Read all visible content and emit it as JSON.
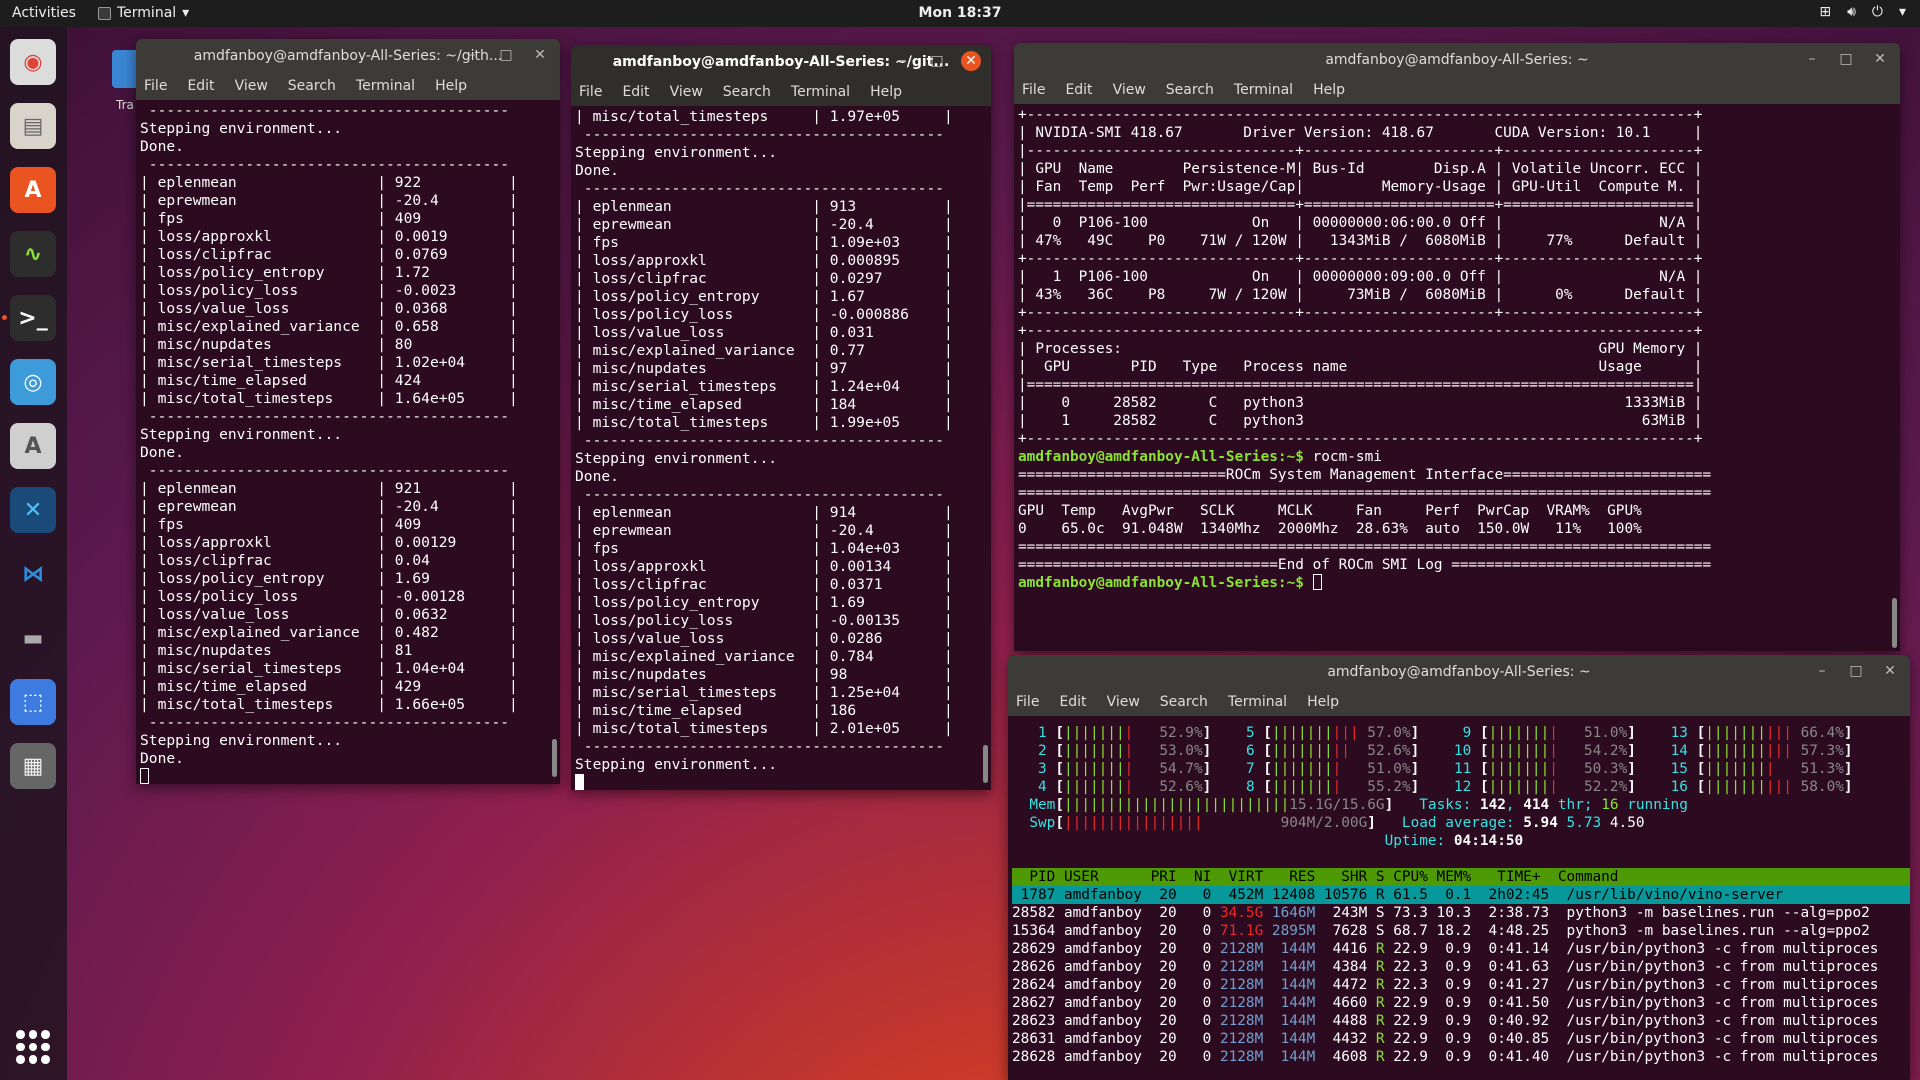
{
  "topbar": {
    "activities": "Activities",
    "app": "Terminal",
    "clock": "Mon 18:37"
  },
  "dock": {
    "items": [
      {
        "name": "chrome-icon",
        "bg": "#dcdcdc",
        "glyph": "◉",
        "color": "#db4437"
      },
      {
        "name": "files-icon",
        "bg": "#d8d4cc",
        "glyph": "▤",
        "color": "#666"
      },
      {
        "name": "software-center-icon",
        "bg": "#e95420",
        "glyph": "A",
        "color": "#fff"
      },
      {
        "name": "system-monitor-icon",
        "bg": "#2d2d2d",
        "glyph": "∿",
        "color": "#8ae234"
      },
      {
        "name": "terminal-icon",
        "bg": "#2d2d2d",
        "glyph": ">_",
        "color": "#fff"
      },
      {
        "name": "browser-globe-icon",
        "bg": "#3d9bd9",
        "glyph": "◎",
        "color": "#fff"
      },
      {
        "name": "software-updater-icon",
        "bg": "#cfcfcf",
        "glyph": "A",
        "color": "#555"
      },
      {
        "name": "remote-app-icon",
        "bg": "#1a4a7a",
        "glyph": "✕",
        "color": "#4fc3f7"
      },
      {
        "name": "vscode-icon",
        "bg": "transparent",
        "glyph": "⋈",
        "color": "#2b8fe0"
      },
      {
        "name": "anbox-icon",
        "bg": "transparent",
        "glyph": "▬",
        "color": "#aaa"
      },
      {
        "name": "screenshot-icon",
        "bg": "#3d7be0",
        "glyph": "⬚",
        "color": "#fff"
      },
      {
        "name": "video-editor-icon",
        "bg": "#666",
        "glyph": "▦",
        "color": "#eee"
      }
    ]
  },
  "desktop": {
    "trash_label": "Tra"
  },
  "menu": [
    "File",
    "Edit",
    "View",
    "Search",
    "Terminal",
    "Help"
  ],
  "windows": {
    "w1": {
      "title": "amdfanboy@amdfanboy-All-Series: ~/gith...",
      "lines": [
        " -----------------------------------------",
        "Stepping environment...",
        "Done.",
        " -----------------------------------------",
        "| eplenmean                | 922          |",
        "| eprewmean                | -20.4        |",
        "| fps                      | 409          |",
        "| loss/approxkl            | 0.0019       |",
        "| loss/clipfrac            | 0.0769       |",
        "| loss/policy_entropy      | 1.72         |",
        "| loss/policy_loss         | -0.0023      |",
        "| loss/value_loss          | 0.0368       |",
        "| misc/explained_variance  | 0.658        |",
        "| misc/nupdates            | 80           |",
        "| misc/serial_timesteps    | 1.02e+04     |",
        "| misc/time_elapsed        | 424          |",
        "| misc/total_timesteps     | 1.64e+05     |",
        " -----------------------------------------",
        "Stepping environment...",
        "Done.",
        " -----------------------------------------",
        "| eplenmean                | 921          |",
        "| eprewmean                | -20.4        |",
        "| fps                      | 409          |",
        "| loss/approxkl            | 0.00129      |",
        "| loss/clipfrac            | 0.04         |",
        "| loss/policy_entropy      | 1.69         |",
        "| loss/policy_loss         | -0.00128     |",
        "| loss/value_loss          | 0.0632       |",
        "| misc/explained_variance  | 0.482        |",
        "| misc/nupdates            | 81           |",
        "| misc/serial_timesteps    | 1.04e+04     |",
        "| misc/time_elapsed        | 429          |",
        "| misc/total_timesteps     | 1.66e+05     |",
        " -----------------------------------------",
        "Stepping environment...",
        "Done."
      ]
    },
    "w2": {
      "title": "amdfanboy@amdfanboy-All-Series: ~/git...",
      "lines": [
        "| misc/total_timesteps     | 1.97e+05     |",
        " -----------------------------------------",
        "Stepping environment...",
        "Done.",
        " -----------------------------------------",
        "| eplenmean                | 913          |",
        "| eprewmean                | -20.4        |",
        "| fps                      | 1.09e+03     |",
        "| loss/approxkl            | 0.000895     |",
        "| loss/clipfrac            | 0.0297       |",
        "| loss/policy_entropy      | 1.67         |",
        "| loss/policy_loss         | -0.000886    |",
        "| loss/value_loss          | 0.031        |",
        "| misc/explained_variance  | 0.77         |",
        "| misc/nupdates            | 97           |",
        "| misc/serial_timesteps    | 1.24e+04     |",
        "| misc/time_elapsed        | 184          |",
        "| misc/total_timesteps     | 1.99e+05     |",
        " -----------------------------------------",
        "Stepping environment...",
        "Done.",
        " -----------------------------------------",
        "| eplenmean                | 914          |",
        "| eprewmean                | -20.4        |",
        "| fps                      | 1.04e+03     |",
        "| loss/approxkl            | 0.00134      |",
        "| loss/clipfrac            | 0.0371       |",
        "| loss/policy_entropy      | 1.69         |",
        "| loss/policy_loss         | -0.00135     |",
        "| loss/value_loss          | 0.0286       |",
        "| misc/explained_variance  | 0.784        |",
        "| misc/nupdates            | 98           |",
        "| misc/serial_timesteps    | 1.25e+04     |",
        "| misc/time_elapsed        | 186          |",
        "| misc/total_timesteps     | 2.01e+05     |",
        " -----------------------------------------",
        "Stepping environment..."
      ]
    },
    "w3": {
      "title": "amdfanboy@amdfanboy-All-Series: ~",
      "lines": [
        "+-----------------------------------------------------------------------------+",
        "| NVIDIA-SMI 418.67       Driver Version: 418.67       CUDA Version: 10.1     |",
        "|-------------------------------+----------------------+----------------------+",
        "| GPU  Name        Persistence-M| Bus-Id        Disp.A | Volatile Uncorr. ECC |",
        "| Fan  Temp  Perf  Pwr:Usage/Cap|         Memory-Usage | GPU-Util  Compute M. |",
        "|===============================+======================+======================|",
        "|   0  P106-100            On   | 00000000:06:00.0 Off |                  N/A |",
        "| 47%   49C    P0    71W / 120W |   1343MiB /  6080MiB |     77%      Default |",
        "+-------------------------------+----------------------+----------------------+",
        "|   1  P106-100            On   | 00000000:09:00.0 Off |                  N/A |",
        "| 43%   36C    P8     7W / 120W |     73MiB /  6080MiB |      0%      Default |",
        "+-------------------------------+----------------------+----------------------+",
        "",
        "+-----------------------------------------------------------------------------+",
        "| Processes:                                                       GPU Memory |",
        "|  GPU       PID   Type   Process name                             Usage      |",
        "|=============================================================================|",
        "|    0     28582      C   python3                                     1333MiB |",
        "|    1     28582      C   python3                                       63MiB |",
        "+-----------------------------------------------------------------------------+"
      ],
      "prompt": "amdfanboy@amdfanboy-All-Series:~$",
      "cmd": " rocm-smi",
      "lines2": [
        "",
        "",
        "========================ROCm System Management Interface========================",
        "================================================================================",
        "GPU  Temp   AvgPwr   SCLK     MCLK     Fan     Perf  PwrCap  VRAM%  GPU%",
        "0    65.0c  91.048W  1340Mhz  2000Mhz  28.63%  auto  150.0W   11%   100%",
        "================================================================================",
        "==============================End of ROCm SMI Log =============================="
      ],
      "prompt2": "amdfanboy@amdfanboy-All-Series:~$"
    },
    "w4": {
      "title": "amdfanboy@amdfanboy-All-Series: ~",
      "cpus": [
        [
          {
            "n": "1",
            "b": "||||||||",
            "p": "52.9%"
          },
          {
            "n": "5",
            "b": "||||||||||",
            "p": "57.0%"
          },
          {
            "n": "9",
            "b": "||||||||",
            "p": "51.0%"
          },
          {
            "n": "13",
            "b": "||||||||||",
            "p": "66.4%"
          }
        ],
        [
          {
            "n": "2",
            "b": "||||||||",
            "p": "53.0%"
          },
          {
            "n": "6",
            "b": "|||||||||",
            "p": "52.6%"
          },
          {
            "n": "10",
            "b": "||||||||",
            "p": "54.2%"
          },
          {
            "n": "14",
            "b": "||||||||||",
            "p": "57.3%"
          }
        ],
        [
          {
            "n": "3",
            "b": "||||||||",
            "p": "54.7%"
          },
          {
            "n": "7",
            "b": "||||||||",
            "p": "51.0%"
          },
          {
            "n": "11",
            "b": "||||||||",
            "p": "50.3%"
          },
          {
            "n": "15",
            "b": "||||||||",
            "p": "51.3%"
          }
        ],
        [
          {
            "n": "4",
            "b": "||||||||",
            "p": "52.6%"
          },
          {
            "n": "8",
            "b": "||||||||",
            "p": "55.2%"
          },
          {
            "n": "12",
            "b": "||||||||",
            "p": "52.2%"
          },
          {
            "n": "16",
            "b": "||||||||||",
            "p": "58.0%"
          }
        ]
      ],
      "mem": {
        "label": "Mem",
        "bar": "||||||||||||||||||||||||||",
        "val": "15.1G/15.6G"
      },
      "swp": {
        "label": "Swp",
        "bar": "||||||||||||||||",
        "val": "904M/2.00G"
      },
      "tasks": {
        "label": "Tasks: ",
        "n": "142",
        "sep": ", ",
        "thr": "414",
        "thr_l": " thr; ",
        "run": "16",
        "run_l": " running"
      },
      "load": {
        "label": "Load average: ",
        "a": "5.94",
        "b": "5.73",
        "c": "4.50"
      },
      "uptime": {
        "label": "Uptime: ",
        "v": "04:14:50"
      },
      "header": "  PID USER      PRI  NI  VIRT   RES   SHR S CPU% MEM%   TIME+  Command",
      "procs": [
        {
          "pid": " 1787",
          "user": "amdfanboy",
          "pri": "20",
          "ni": "0",
          "virt": "452M",
          "res": "12408",
          "shr": "10576",
          "s": "R",
          "cpu": "61.5",
          "mem": "0.1",
          "time": "2h02:45",
          "cmd": "/usr/lib/vino/vino-server"
        },
        {
          "pid": "28582",
          "user": "amdfanboy",
          "pri": "20",
          "ni": "0",
          "virt": "34.5G",
          "res": "1646M",
          "shr": "243M",
          "s": "S",
          "cpu": "73.3",
          "mem": "10.3",
          "time": "2:38.73",
          "cmd": "python3 -m baselines.run --alg=ppo2"
        },
        {
          "pid": "15364",
          "user": "amdfanboy",
          "pri": "20",
          "ni": "0",
          "virt": "71.1G",
          "res": "2895M",
          "shr": "7628",
          "s": "S",
          "cpu": "68.7",
          "mem": "18.2",
          "time": "4:48.25",
          "cmd": "python3 -m baselines.run --alg=ppo2"
        },
        {
          "pid": "28629",
          "user": "amdfanboy",
          "pri": "20",
          "ni": "0",
          "virt": "2128M",
          "res": "144M",
          "shr": "4416",
          "s": "R",
          "cpu": "22.9",
          "mem": "0.9",
          "time": "0:41.14",
          "cmd": "/usr/bin/python3 -c from multiproces"
        },
        {
          "pid": "28626",
          "user": "amdfanboy",
          "pri": "20",
          "ni": "0",
          "virt": "2128M",
          "res": "144M",
          "shr": "4384",
          "s": "R",
          "cpu": "22.3",
          "mem": "0.9",
          "time": "0:41.63",
          "cmd": "/usr/bin/python3 -c from multiproces"
        },
        {
          "pid": "28624",
          "user": "amdfanboy",
          "pri": "20",
          "ni": "0",
          "virt": "2128M",
          "res": "144M",
          "shr": "4472",
          "s": "R",
          "cpu": "22.3",
          "mem": "0.9",
          "time": "0:41.27",
          "cmd": "/usr/bin/python3 -c from multiproces"
        },
        {
          "pid": "28627",
          "user": "amdfanboy",
          "pri": "20",
          "ni": "0",
          "virt": "2128M",
          "res": "144M",
          "shr": "4660",
          "s": "R",
          "cpu": "22.9",
          "mem": "0.9",
          "time": "0:41.50",
          "cmd": "/usr/bin/python3 -c from multiproces"
        },
        {
          "pid": "28623",
          "user": "amdfanboy",
          "pri": "20",
          "ni": "0",
          "virt": "2128M",
          "res": "144M",
          "shr": "4488",
          "s": "R",
          "cpu": "22.9",
          "mem": "0.9",
          "time": "0:40.92",
          "cmd": "/usr/bin/python3 -c from multiproces"
        },
        {
          "pid": "28631",
          "user": "amdfanboy",
          "pri": "20",
          "ni": "0",
          "virt": "2128M",
          "res": "144M",
          "shr": "4432",
          "s": "R",
          "cpu": "22.9",
          "mem": "0.9",
          "time": "0:40.85",
          "cmd": "/usr/bin/python3 -c from multiproces"
        },
        {
          "pid": "28628",
          "user": "amdfanboy",
          "pri": "20",
          "ni": "0",
          "virt": "2128M",
          "res": "144M",
          "shr": "4608",
          "s": "R",
          "cpu": "22.9",
          "mem": "0.9",
          "time": "0:41.40",
          "cmd": "/usr/bin/python3 -c from multiproces"
        }
      ]
    }
  }
}
